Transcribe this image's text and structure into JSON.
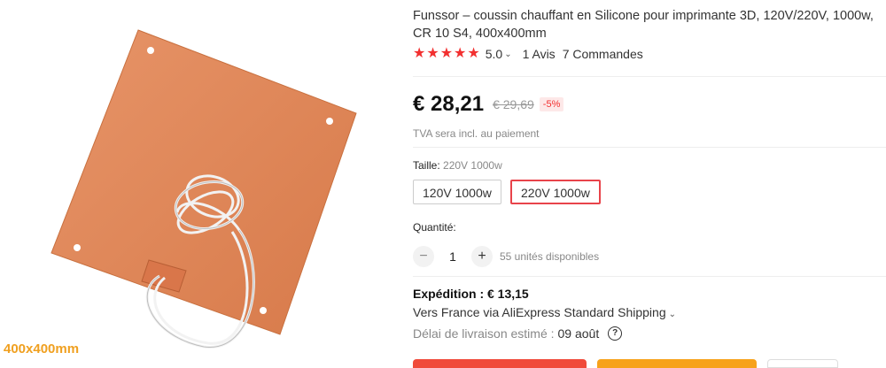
{
  "product": {
    "image_caption": "400x400mm",
    "title": "Funssor – coussin chauffant en Silicone pour imprimante 3D, 120V/220V, 1000w, CR 10 S4, 400x400mm",
    "rating": "5.0",
    "reviews": "1 Avis",
    "orders": "7 Commandes",
    "price": "€ 28,21",
    "old_price": "€ 29,69",
    "discount": "-5%",
    "tva": "TVA sera incl. au paiement"
  },
  "size": {
    "label": "Taille:",
    "selected": "220V 1000w",
    "options": [
      "120V 1000w",
      "220V 1000w"
    ]
  },
  "quantity": {
    "label": "Quantité:",
    "minus": "−",
    "value": "1",
    "plus": "+",
    "available": "55 unités disponibles"
  },
  "shipping": {
    "header": "Expédition : € 13,15",
    "method": "Vers France via AliExpress Standard Shipping",
    "delivery_label": "Délai de livraison estimé :",
    "delivery_date": "09 août",
    "help": "?"
  },
  "colors": {
    "accent": "#e8434a",
    "star": "#f23030",
    "pad": "#e28a5a",
    "caption": "#f0a020",
    "buy_now": "#f04a3a",
    "add_cart": "#f7a21b"
  },
  "icons": {
    "star": "★",
    "chevron": "⌄"
  }
}
